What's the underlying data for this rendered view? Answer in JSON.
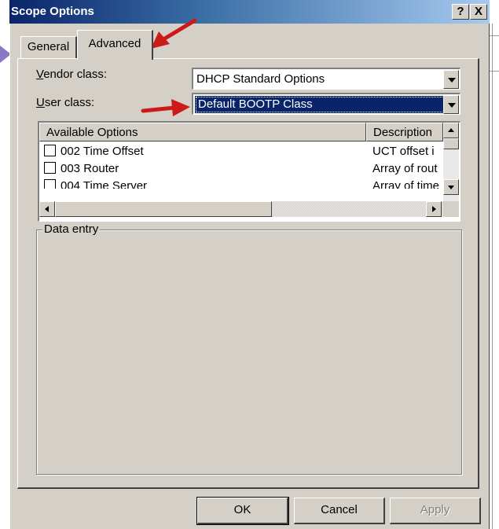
{
  "window": {
    "title": "Scope Options",
    "help_btn": "?",
    "close_btn": "X"
  },
  "tabs": [
    {
      "label": "General"
    },
    {
      "label": "Advanced"
    }
  ],
  "vendor_class": {
    "label_prefix": "V",
    "label_rest": "endor class:",
    "value": "DHCP Standard Options"
  },
  "user_class": {
    "label_prefix": "U",
    "label_rest": "ser class:",
    "value": "Default BOOTP Class"
  },
  "options_list": {
    "columns": [
      "Available Options",
      "Description"
    ],
    "rows": [
      {
        "name": "002 Time Offset",
        "desc": "UCT offset i"
      },
      {
        "name": "003 Router",
        "desc": "Array of rout"
      },
      {
        "name": "004 Time Server",
        "desc": "Array of time"
      }
    ]
  },
  "data_entry": {
    "label": "Data entry"
  },
  "buttons": {
    "ok": "OK",
    "cancel": "Cancel",
    "apply": "Apply"
  },
  "colors": {
    "title_bar": "#0a246a",
    "face": "#d4d0c8",
    "selection": "#0a246a",
    "annotation_arrow": "#cc1a1a",
    "side_arrow": "#8a78c4"
  }
}
